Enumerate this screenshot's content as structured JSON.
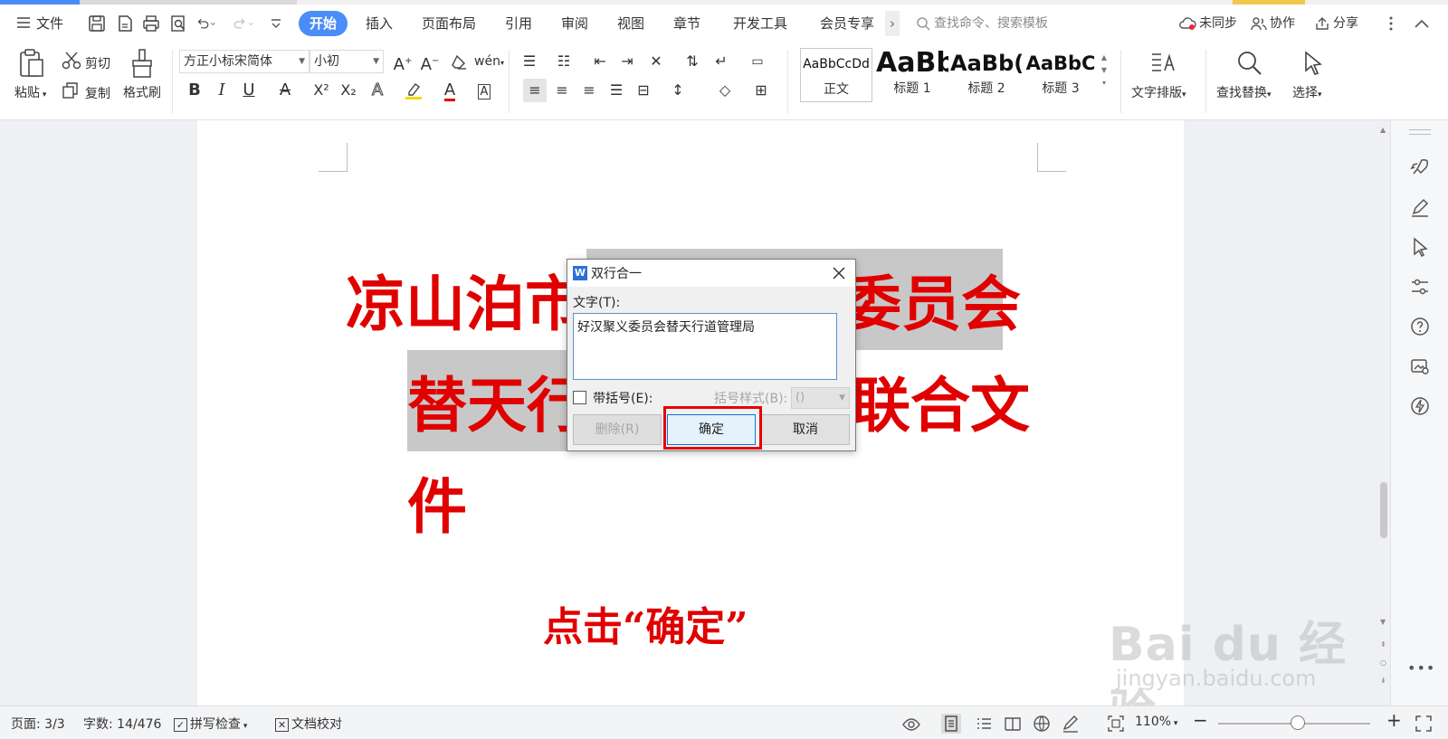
{
  "menubar": {
    "file": "文件",
    "tabs": [
      "开始",
      "插入",
      "页面布局",
      "引用",
      "审阅",
      "视图",
      "章节",
      "开发工具",
      "会员专享"
    ],
    "more": "›",
    "search_placeholder": "查找命令、搜索模板",
    "sync": "未同步",
    "collab": "协作",
    "share": "分享"
  },
  "ribbon": {
    "paste": "粘贴",
    "cut": "剪切",
    "copy": "复制",
    "format_painter": "格式刷",
    "font_name": "方正小标宋简体",
    "font_size": "小初",
    "bold": "B",
    "italic": "I",
    "underline": "U",
    "superscript": "X²",
    "subscript": "X₂",
    "styles": [
      {
        "preview": "AaBbCcDd",
        "label": "正文"
      },
      {
        "preview": "AaBb",
        "label": "标题 1"
      },
      {
        "preview": "AaBb(",
        "label": "标题 2"
      },
      {
        "preview": "AaBbC",
        "label": "标题 3"
      }
    ],
    "text_layout": "文字排版",
    "find_replace": "查找替换",
    "select": "选择"
  },
  "document": {
    "line1_left": "凉山泊市",
    "line1_right": "委员会",
    "line2_left": "替天行",
    "line2_right": "联合文",
    "line3": "件",
    "annotation": "点击“确定”"
  },
  "dialog": {
    "title": "双行合一",
    "text_label": "文字(T):",
    "text_value": "好汉聚义委员会替天行道管理局",
    "bracket_label": "带括号(E):",
    "bracket_style_label": "括号样式(B):",
    "bracket_style_value": "()",
    "delete_button": "删除(R)",
    "ok_button": "确定",
    "cancel_button": "取消"
  },
  "status": {
    "page": "页面: 3/3",
    "words": "字数: 14/476",
    "spell": "拼写检查",
    "proof": "文档校对",
    "zoom": "110%",
    "minus": "−",
    "plus": "+"
  },
  "watermark": {
    "brand": "Bai du 经验",
    "url": "jingyan.baidu.com"
  },
  "colors": {
    "accent": "#4b8df8",
    "doc_text": "#e00000",
    "highlight": "#c8c8c8",
    "callout_box": "#e60000"
  }
}
